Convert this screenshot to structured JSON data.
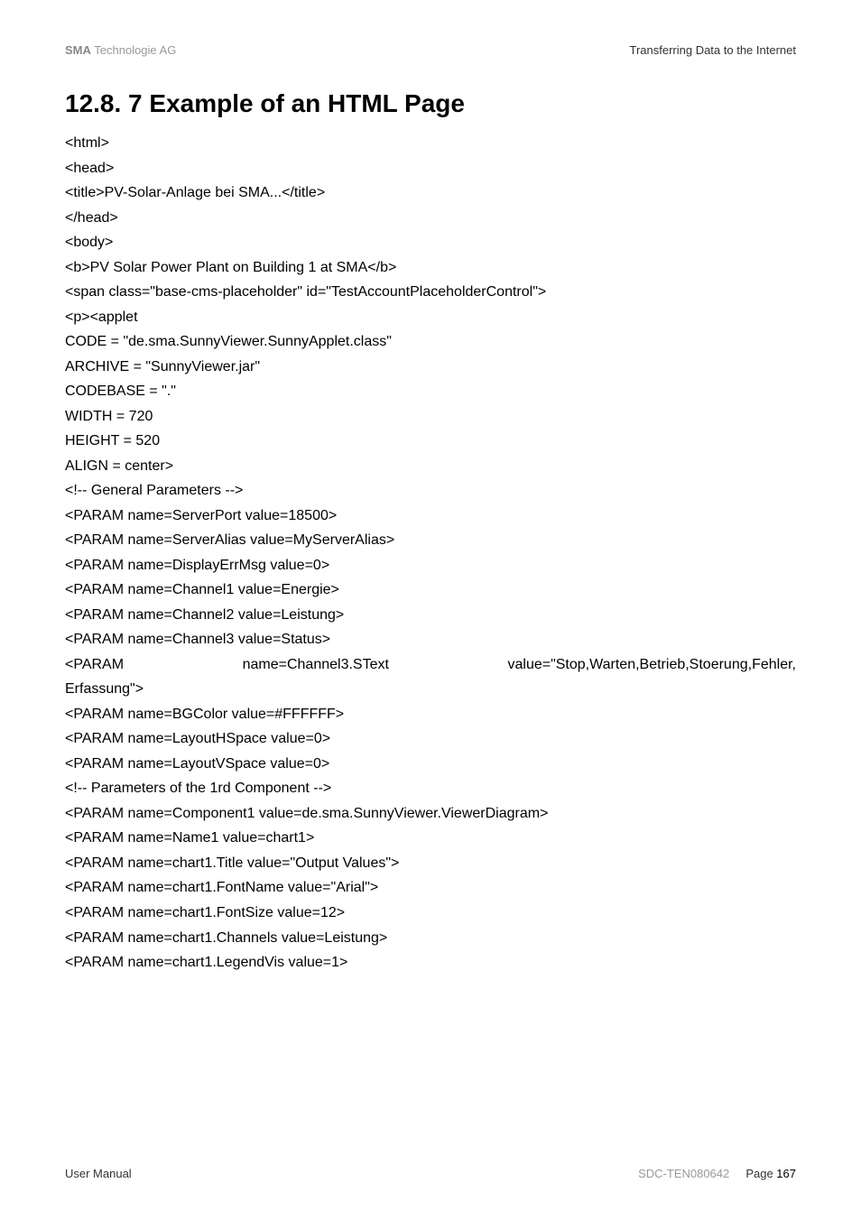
{
  "header": {
    "brand_bold": "SMA",
    "brand_rest": " Technologie AG",
    "right": "Transferring Data to the Internet"
  },
  "heading": "12.8. 7 Example of an HTML Page",
  "code": {
    "l1": "<html>",
    "l2": "<head>",
    "l3": "<title>PV-Solar-Anlage bei SMA...</title>",
    "l4": "</head>",
    "l5": "<body>",
    "l6": "<b>PV Solar Power Plant on Building 1 at SMA</b>",
    "l7": "<span class=\"base-cms-placeholder\" id=\"TestAccountPlaceholderControl\">",
    "l8": "<p><applet",
    "l9": "CODE = \"de.sma.SunnyViewer.SunnyApplet.class\"",
    "l10": "ARCHIVE = \"SunnyViewer.jar\"",
    "l11": "CODEBASE = \".\"",
    "l12": "WIDTH = 720",
    "l13": "HEIGHT = 520",
    "l14": "ALIGN = center>",
    "l15": "<!-- General Parameters -->",
    "l16": "<PARAM name=ServerPort value=18500>",
    "l17": "<PARAM name=ServerAlias value=MyServerAlias>",
    "l18": "<PARAM name=DisplayErrMsg value=0>",
    "l19": "<PARAM name=Channel1 value=Energie>",
    "l20": "<PARAM name=Channel2 value=Leistung>",
    "l21": "<PARAM name=Channel3 value=Status>",
    "l22a": "<PARAM",
    "l22b": "name=Channel3.SText",
    "l22c": "value=\"Stop,Warten,Betrieb,Stoerung,Fehler,",
    "l23": "Erfassung\">",
    "l24": "<PARAM name=BGColor value=#FFFFFF>",
    "l25": "<PARAM name=LayoutHSpace value=0>",
    "l26": "<PARAM name=LayoutVSpace value=0>",
    "l27": "<!-- Parameters of the 1rd Component -->",
    "l28": "<PARAM name=Component1 value=de.sma.SunnyViewer.ViewerDiagram>",
    "l29": "<PARAM name=Name1 value=chart1>",
    "l30": "<PARAM name=chart1.Title value=\"Output Values\">",
    "l31": "<PARAM name=chart1.FontName value=\"Arial\">",
    "l32": "<PARAM name=chart1.FontSize value=12>",
    "l33": "<PARAM name=chart1.Channels value=Leistung>",
    "l34": "<PARAM name=chart1.LegendVis value=1>"
  },
  "footer": {
    "left": "User Manual",
    "center": "SDC-TEN080642",
    "right_label": "Page ",
    "right_num": "167"
  }
}
